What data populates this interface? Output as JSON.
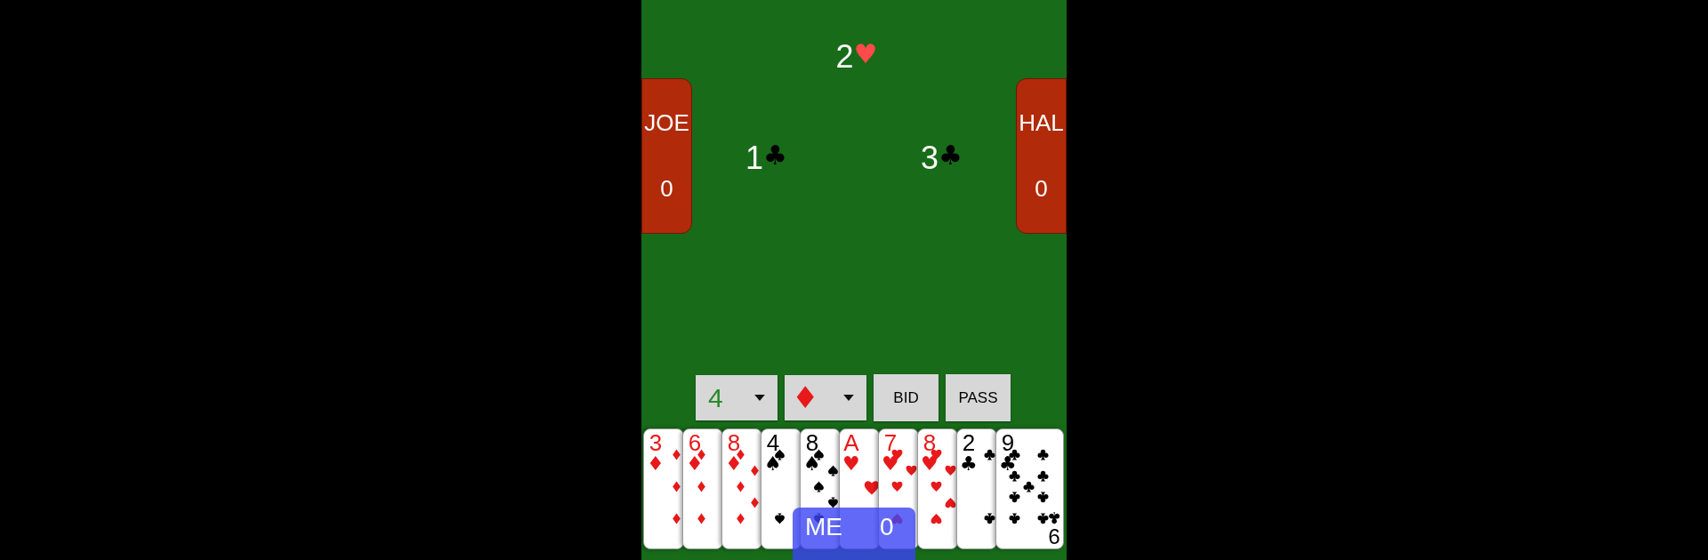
{
  "bids": {
    "north": {
      "number": "2",
      "symbol": "♥",
      "color": "#ff4a4a"
    },
    "west": {
      "number": "1",
      "symbol": "♣",
      "color": "#000000"
    },
    "east": {
      "number": "3",
      "symbol": "♣",
      "color": "#000000"
    }
  },
  "players": [
    {
      "name": "JOE",
      "score": "0"
    },
    {
      "name": "HAL",
      "score": "0"
    }
  ],
  "controls": [
    {
      "kind": "rank-dropdown",
      "value": "4"
    },
    {
      "kind": "suit-dropdown",
      "value": "♦"
    },
    {
      "kind": "button",
      "label": "BID"
    },
    {
      "kind": "button",
      "label": "PASS"
    }
  ],
  "hand": [
    {
      "rank": "3",
      "symbol": "♦",
      "kind": "diamonds",
      "color": "#e8191b"
    },
    {
      "rank": "6",
      "symbol": "♦",
      "kind": "diamonds",
      "color": "#e8191b"
    },
    {
      "rank": "8",
      "symbol": "♦",
      "kind": "diamonds",
      "color": "#e8191b"
    },
    {
      "rank": "4",
      "symbol": "♠",
      "kind": "spades",
      "color": "#000000"
    },
    {
      "rank": "8",
      "symbol": "♠",
      "kind": "spades",
      "color": "#000000"
    },
    {
      "rank": "A",
      "symbol": "♥",
      "kind": "hearts",
      "color": "#e8191b"
    },
    {
      "rank": "7",
      "symbol": "♥",
      "kind": "hearts",
      "color": "#e8191b"
    },
    {
      "rank": "8",
      "symbol": "♥",
      "kind": "hearts",
      "color": "#e8191b"
    },
    {
      "rank": "2",
      "symbol": "♣",
      "kind": "clubs",
      "color": "#000000"
    },
    {
      "rank": "9",
      "symbol": "♣",
      "kind": "clubs",
      "color": "#000000",
      "bottom_rank": "9",
      "bottom_symbol": "♣"
    }
  ],
  "me": {
    "name": "ME",
    "score": "0"
  }
}
